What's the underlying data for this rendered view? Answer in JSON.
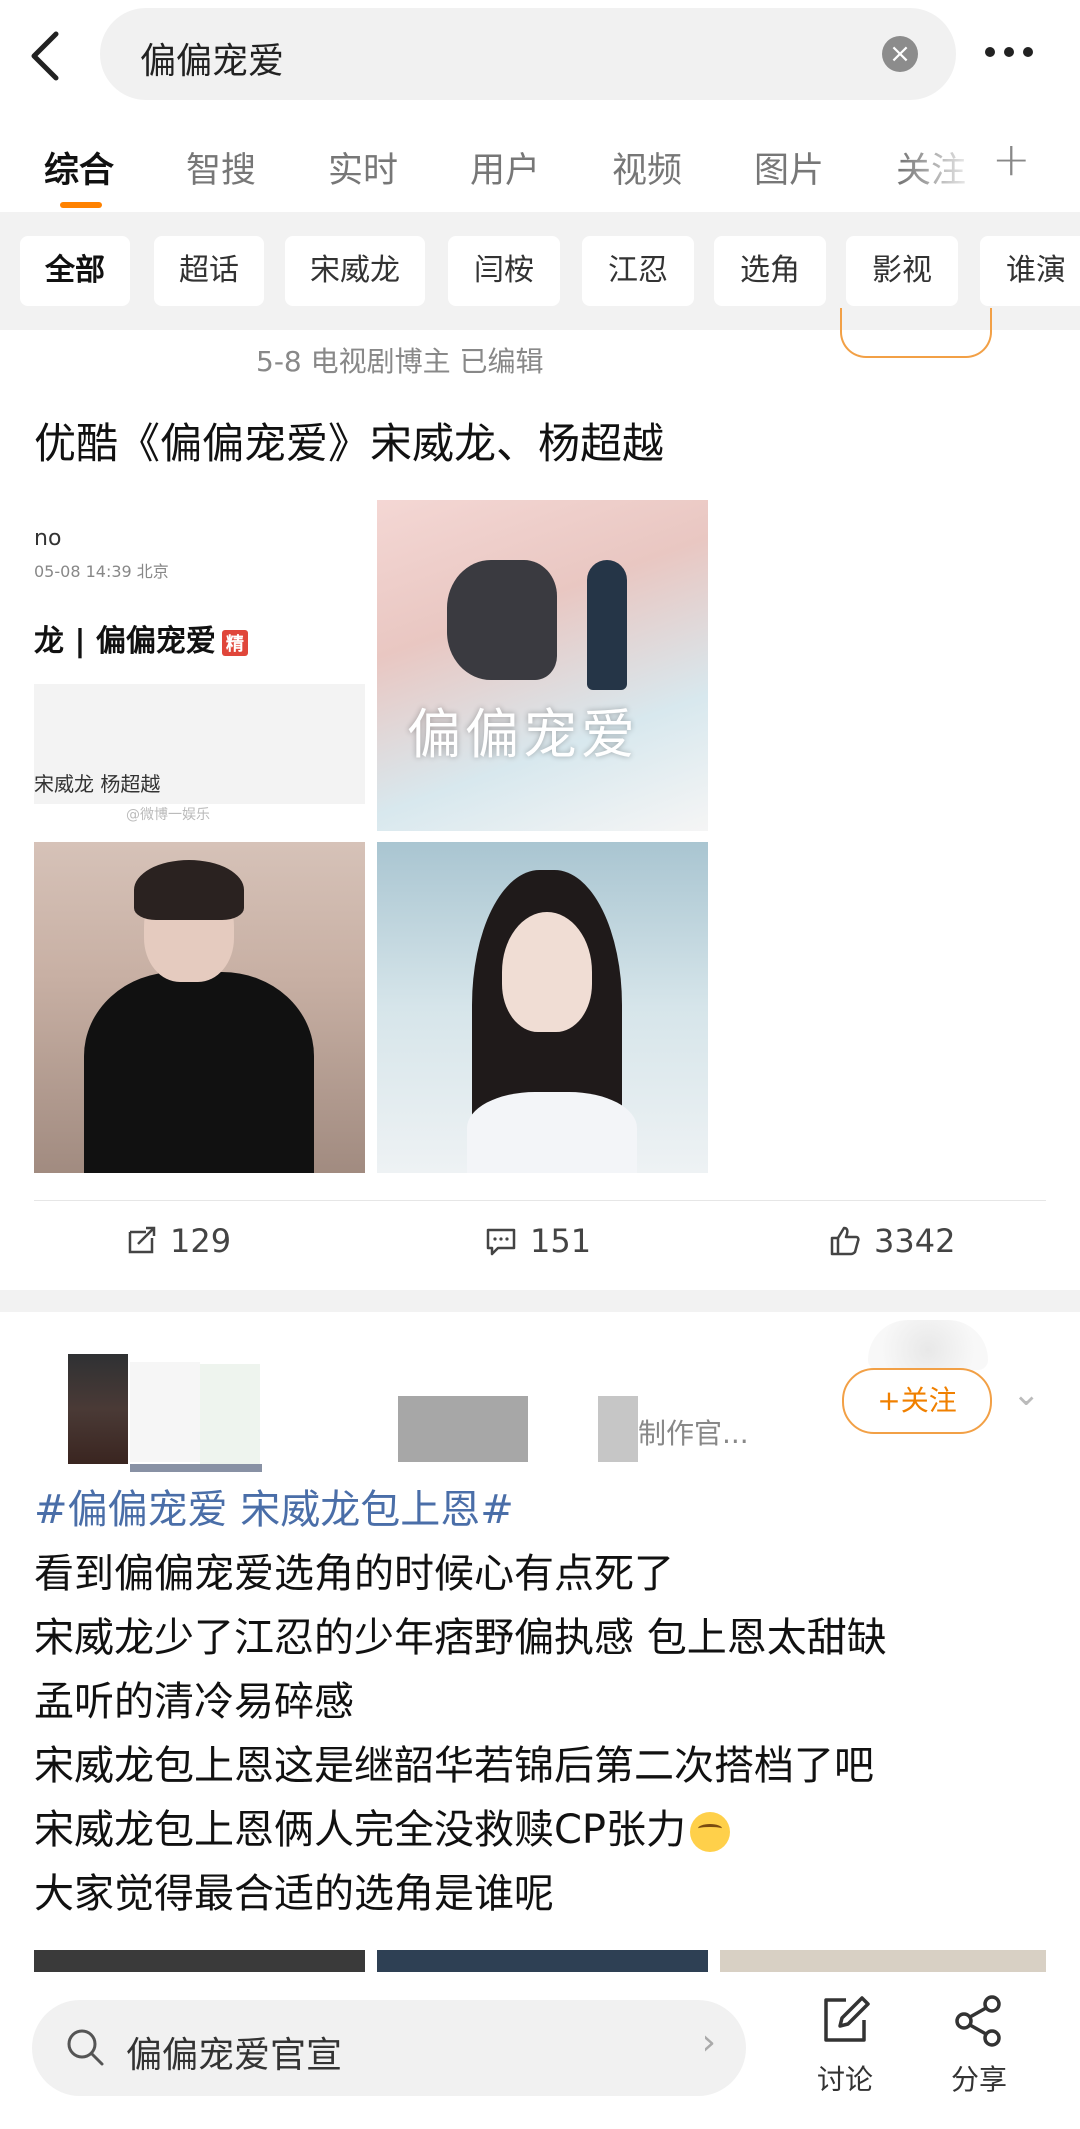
{
  "search": {
    "query": "偏偏宠爱"
  },
  "tabs": [
    "综合",
    "智搜",
    "实时",
    "用户",
    "视频",
    "图片",
    "关注"
  ],
  "filters": [
    "全部",
    "超话",
    "宋威龙",
    "闫桉",
    "江忍",
    "选角",
    "影视",
    "谁演"
  ],
  "post1": {
    "meta": "5-8  电视剧博主  已编辑",
    "title": "优酷《偏偏宠爱》宋威龙、杨超越",
    "screenshot": {
      "user": "no",
      "time": "05-08 14:39 北京",
      "topic": "龙 | 偏偏宠爱",
      "badge": "精",
      "names": "宋威龙 杨超越",
      "watermark": "@微博一娱乐"
    },
    "poster_title": "偏偏宠爱",
    "stats": {
      "reposts": "129",
      "comments": "151",
      "likes": "3342"
    }
  },
  "post2": {
    "source": "制作官...",
    "follow_label": "+关注",
    "hashtag": "#偏偏宠爱 宋威龙包上恩#",
    "lines": [
      "看到偏偏宠爱选角的时候心有点死了",
      "宋威龙少了江忍的少年痞野偏执感 包上恩太甜缺",
      "孟听的清冷易碎感",
      "宋威龙包上恩这是继韶华若锦后第二次搭档了吧",
      "宋威龙包上恩俩人完全没救赎CP张力",
      "大家觉得最合适的选角是谁呢"
    ]
  },
  "bottom": {
    "search_text": "偏偏宠爱官宣",
    "discuss_label": "讨论",
    "share_label": "分享"
  },
  "colors": {
    "accent": "#ff8200",
    "link": "#4a6ea8"
  }
}
